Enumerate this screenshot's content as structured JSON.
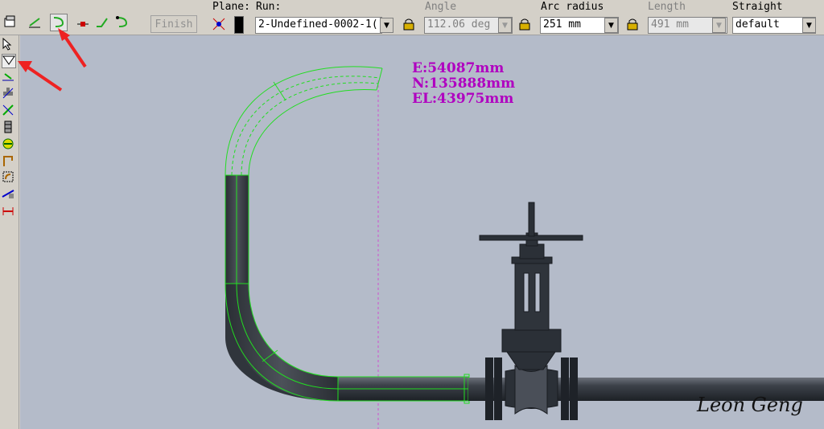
{
  "toolbar": {
    "buttons": [
      {
        "name": "properties-icon"
      },
      {
        "name": "line-segment-icon"
      },
      {
        "name": "arc-bend-icon"
      },
      {
        "name": "line-start-icon"
      },
      {
        "name": "line-bend-icon"
      },
      {
        "name": "arc-turn-icon"
      }
    ],
    "finish_label": "Finish",
    "plane_label": "Plane:",
    "run_label": "Run:",
    "run_value": "2-Undefined-0002-1(",
    "angle_label": "Angle",
    "angle_value": "112.06 deg",
    "arc_radius_label": "Arc radius",
    "arc_radius_value": "251 mm",
    "length_label": "Length",
    "length_value": "491 mm",
    "straight_label": "Straight",
    "straight_value": "default"
  },
  "left_toolbar": {
    "icons": [
      "select-arrow-icon",
      "route-tool-icon",
      "connect-icon",
      "tee-icon",
      "branch-icon",
      "valve-icon",
      "reducer-icon",
      "support-icon",
      "elbow-icon",
      "flange-icon",
      "measure-icon"
    ]
  },
  "viewport": {
    "coords": {
      "e": "E:54087mm",
      "n": "N:135888mm",
      "el": "EL:43975mm"
    },
    "signature": "Leon Geng"
  },
  "colors": {
    "viewport_bg": "#b4bbc9",
    "route_green": "#22dd22",
    "coord_text": "#b000c0",
    "pipe_dark": "#33383f"
  }
}
